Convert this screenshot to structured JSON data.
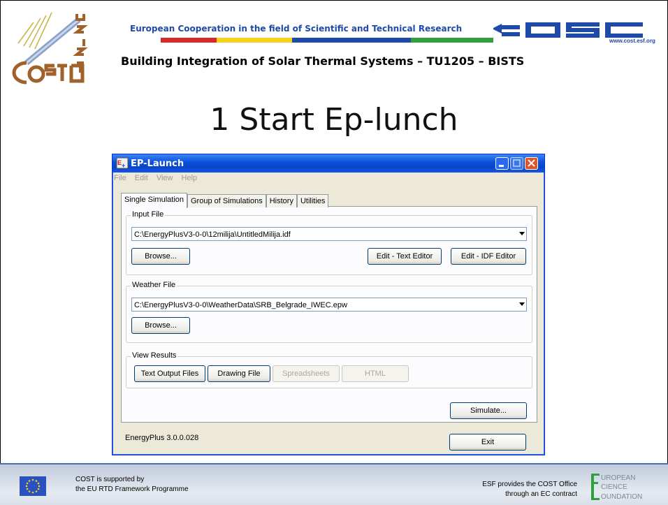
{
  "header": {
    "subtitle": "European Cooperation in the field of Scientific and Technical Research",
    "title": "Building Integration of Solar Thermal Systems – TU1205 – BISTS",
    "cost_url": "www.cost.esf.org",
    "colorbar": [
      "#d42a2a",
      "#f6d11e",
      "#1f4aa8",
      "#2ea13a"
    ]
  },
  "slide": {
    "title": "1 Start Ep-lunch"
  },
  "window": {
    "title": "EP-Launch",
    "menu": [
      "File",
      "Edit",
      "View",
      "Help"
    ],
    "tabs": [
      "Single Simulation",
      "Group of Simulations",
      "History",
      "Utilities"
    ],
    "active_tab": "Single Simulation",
    "input_file": {
      "label": "Input File",
      "value": "C:\\EnergyPlusV3-0-0\\12milija\\UntitledMilija.idf",
      "browse": "Browse...",
      "edit_text": "Edit - Text Editor",
      "edit_idf": "Edit - IDF Editor"
    },
    "weather_file": {
      "label": "Weather File",
      "value": "C:\\EnergyPlusV3-0-0\\WeatherData\\SRB_Belgrade_IWEC.epw",
      "browse": "Browse..."
    },
    "view_results": {
      "label": "View Results",
      "text_output": "Text Output Files",
      "drawing": "Drawing File",
      "spreadsheets": "Spreadsheets",
      "html": "HTML"
    },
    "simulate": "Simulate...",
    "version": "EnergyPlus 3.0.0.028",
    "exit": "Exit"
  },
  "footer": {
    "left_line1": "COST is supported by",
    "left_line2": "the EU RTD Framework Programme",
    "right_line1": "ESF provides the COST Office",
    "right_line2": "through an EC contract",
    "esf_lines": [
      "UROPEAN",
      "CIENCE",
      "OUNDATION"
    ]
  }
}
